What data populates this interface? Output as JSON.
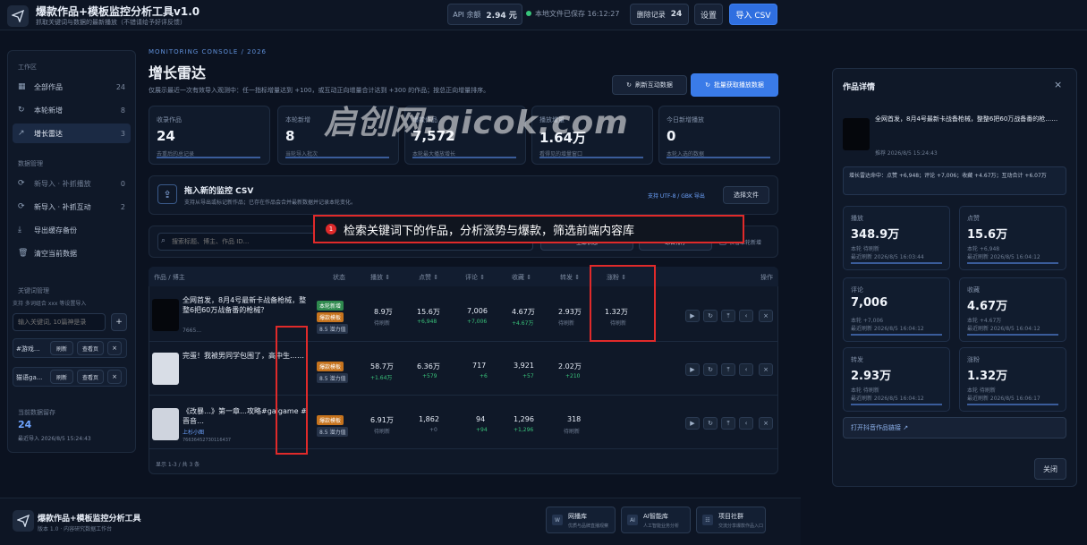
{
  "app": {
    "title": "爆款作品+模板监控分析工具v1.0",
    "subtitle": "抓取关键词与数据的最新播放（不错请给予好评反馈）"
  },
  "header": {
    "api_label": "API 余额",
    "api_value": "2.94 元",
    "save_status": "本地文件已保存 16:12:27",
    "deleted_label": "删除记录",
    "deleted_count": "24",
    "settings": "设置",
    "import_csv": "导入 CSV"
  },
  "sidebar": {
    "section_work": "工作区",
    "items_work": [
      {
        "label": "全部作品",
        "count": "24"
      },
      {
        "label": "本轮新增",
        "count": "8"
      },
      {
        "label": "增长雷达",
        "count": "3"
      }
    ],
    "section_data": "数据管理",
    "items_data": [
      {
        "label": "新导入 · 补抓播放",
        "count": "0"
      },
      {
        "label": "新导入 · 补抓互动",
        "count": "2"
      },
      {
        "label": "导出缓存备份",
        "count": ""
      },
      {
        "label": "清空当前数据",
        "count": ""
      }
    ],
    "section_keyword": "关键词管理",
    "keyword_hint": "支持 多词组合 xxx 等设置导入",
    "keyword_placeholder": "输入关键词, 10篇神是录",
    "keyword_add": "+",
    "keywords": [
      {
        "name": "#游戏...",
        "b1": "刷新",
        "b2": "查看页"
      },
      {
        "name": "猫语ga...",
        "b1": "刷新",
        "b2": "查看页"
      }
    ],
    "close_x": "×",
    "last_label": "当前数据留存",
    "last_count": "24",
    "last_time": "最近导入 2026/8/5 15:24:43"
  },
  "main": {
    "eyebrow": "MONITORING CONSOLE / 2026",
    "title": "增长雷达",
    "desc": "仅展示最近一次有效导入观测中：任一指标增量达到 +100，或互动正向增量合计达到 +300 的作品；按总正向增量排序。",
    "refresh_btn": "刷新互动数据",
    "batch_btn": "批量获取播放数据",
    "kpis": [
      {
        "label": "收录作品",
        "value": "24",
        "sub": "去重后的总记录"
      },
      {
        "label": "本轮新增",
        "value": "8",
        "sub": "当轮导入批次"
      },
      {
        "label": "爆款作品",
        "value": "7,572",
        "sub": "本轮最大播放增长"
      },
      {
        "label": "播放增量",
        "value": "1.64万",
        "sub": "看得见的增量窗口"
      },
      {
        "label": "今日新增播放",
        "value": "0",
        "sub": "本轮入选的数据"
      }
    ],
    "import": {
      "title": "拖入新的监控 CSV",
      "desc": "支持从导出或标记新作品；已存在作品会合并最新数据并记录本轮变化。",
      "encoding": "支持 UTF-8 / GBK 导出",
      "choose": "选择文件"
    },
    "search_placeholder": "搜索标题、博主、作品 ID...",
    "filter1": "全部状态",
    "filter2": "综合排序",
    "filter3": "仅看本轮新增",
    "annotation": "检索关键词下的作品，分析涨势与爆款，筛选前端内容库",
    "annotation_num": "1",
    "columns": [
      "作品 / 博主",
      "状态",
      "播放 ⇕",
      "点赞 ⇕",
      "评论 ⇕",
      "收藏 ⇕",
      "转发 ⇕",
      "涨粉 ⇕",
      "操作"
    ],
    "rows": [
      {
        "title": "全网首发，8月4号最新卡战备枪械，整整6把60万战备番的枪械？",
        "id": "7665...",
        "tags": [
          "本轮新增",
          "爆款模板",
          "8.5 潜力值"
        ],
        "play": "8.9万",
        "play_sub": "待刷新",
        "like": "15.6万",
        "like_d": "+6,948",
        "cmt": "7,006",
        "cmt_d": "+7,006",
        "fav": "4.67万",
        "fav_d": "+4.67万",
        "share": "2.93万",
        "share_d": "待刷新",
        "fans": "1.32万",
        "fans_d": "待刷新"
      },
      {
        "title": "完蛋！我被男同学包围了，高中生……",
        "id": "",
        "tags": [
          "爆款模板",
          "8.5 潜力值"
        ],
        "play": "58.7万",
        "play_sub": "+1.64万",
        "like": "6.36万",
        "like_d": "+579",
        "cmt": "717",
        "cmt_d": "+6",
        "fav": "3,921",
        "fav_d": "+57",
        "share": "2.02万",
        "share_d": "+210",
        "fans": "",
        "fans_d": ""
      },
      {
        "title": "《改暴…》第一章…攻略#galgame #晋音…",
        "id": "76636452730116437",
        "author": "上杉小图",
        "tags": [
          "爆款模板",
          "8.5 潜力值"
        ],
        "play": "6.91万",
        "play_sub": "待刷新",
        "like": "1,862",
        "like_d": "+0",
        "cmt": "94",
        "cmt_d": "+94",
        "fav": "1,296",
        "fav_d": "+1,296",
        "share": "318",
        "share_d": "待刷新",
        "fans": "",
        "fans_d": ""
      }
    ],
    "pager": "显示 1-3 / 共 3 条"
  },
  "detail": {
    "title": "作品详情",
    "close": "×",
    "work_title": "全网首发，8月4号最新卡战备枪械，整整6把60万战备番的枪……",
    "work_meta": "推荐 2026/8/5 15:24:43",
    "note": "增长雷达命中：点赞 +6,948；评论 +7,006；收藏 +4.67万；互动合计 +6.07万",
    "cards": [
      {
        "label": "播放",
        "value": "348.9万",
        "d": "本轮 待刷新",
        "t": "最近刷新 2026/8/5 16:03:44"
      },
      {
        "label": "点赞",
        "value": "15.6万",
        "d": "本轮 +6,948",
        "t": "最近刷新 2026/8/5 16:04:12"
      },
      {
        "label": "评论",
        "value": "7,006",
        "d": "本轮 +7,006",
        "t": "最近刷新 2026/8/5 16:04:12"
      },
      {
        "label": "收藏",
        "value": "4.67万",
        "d": "本轮 +4.67万",
        "t": "最近刷新 2026/8/5 16:04:12"
      },
      {
        "label": "转发",
        "value": "2.93万",
        "d": "本轮 待刷新",
        "t": "最近刷新 2026/8/5 16:04:12"
      },
      {
        "label": "涨粉",
        "value": "1.32万",
        "d": "本轮 待刷新",
        "t": "最近刷新 2026/8/5 16:06:17"
      }
    ],
    "open_link": "打开抖音作品链接 ↗",
    "close_btn": "关闭"
  },
  "footer": {
    "title": "爆款作品+模板监控分析工具",
    "sub": "版本 1.0 · 内容研究数据工作台",
    "buttons": [
      {
        "icon": "W",
        "title": "网播库",
        "sub": "优质与品牌直播观察"
      },
      {
        "icon": "AI",
        "title": "AI智能库",
        "sub": "人工智能业务分析"
      },
      {
        "icon": "☷",
        "title": "项目社群",
        "sub": "交流分享爆款作品入口"
      }
    ]
  },
  "watermark": "启创网:qicok.com"
}
